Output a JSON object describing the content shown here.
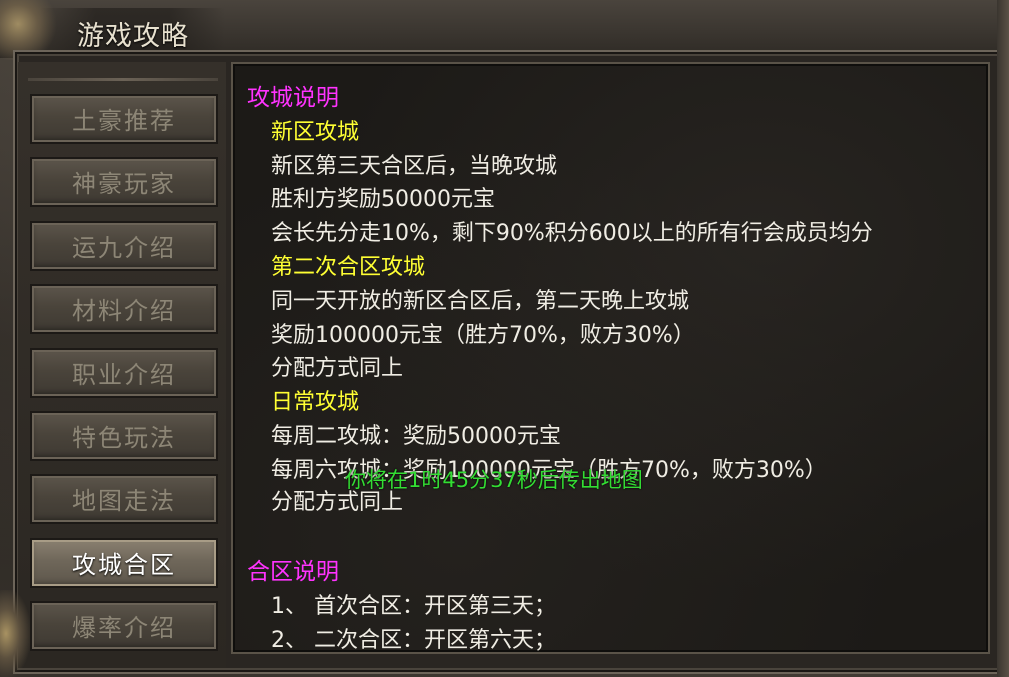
{
  "window": {
    "title": "游戏攻略"
  },
  "sidebar": {
    "items": [
      {
        "label": "土豪推荐",
        "active": false
      },
      {
        "label": "神豪玩家",
        "active": false
      },
      {
        "label": "运九介绍",
        "active": false
      },
      {
        "label": "材料介绍",
        "active": false
      },
      {
        "label": "职业介绍",
        "active": false
      },
      {
        "label": "特色玩法",
        "active": false
      },
      {
        "label": "地图走法",
        "active": false
      },
      {
        "label": "攻城合区",
        "active": true
      },
      {
        "label": "爆率介绍",
        "active": false
      }
    ]
  },
  "content": {
    "lines": [
      {
        "type": "h1",
        "text": "攻城说明"
      },
      {
        "type": "h2",
        "text": "新区攻城"
      },
      {
        "type": "body",
        "text": "新区第三天合区后，当晚攻城"
      },
      {
        "type": "body",
        "text": "胜利方奖励50000元宝"
      },
      {
        "type": "body",
        "text": "会长先分走10%，剩下90%积分600以上的所有行会成员均分"
      },
      {
        "type": "h2",
        "text": "第二次合区攻城"
      },
      {
        "type": "body",
        "text": "同一天开放的新区合区后，第二天晚上攻城"
      },
      {
        "type": "body",
        "text": "奖励100000元宝（胜方70%，败方30%）"
      },
      {
        "type": "body",
        "text": "分配方式同上"
      },
      {
        "type": "h2",
        "text": "日常攻城"
      },
      {
        "type": "body",
        "text": "每周二攻城：奖励50000元宝"
      },
      {
        "type": "body",
        "text": "每周六攻城：奖励100000元宝（胜方70%，败方30%）"
      },
      {
        "type": "body",
        "text": "分配方式同上"
      },
      {
        "type": "h1",
        "text": "合区说明"
      },
      {
        "type": "body",
        "text": "1、 首次合区：开区第三天；"
      },
      {
        "type": "body",
        "text": "2、 二次合区：开区第六天；"
      }
    ]
  },
  "overlay": {
    "message": "你将在1时45分37秒后传出地图"
  },
  "colors": {
    "heading_magenta": "#ff33ff",
    "subheading_yellow": "#ffff33",
    "body_text": "#f0ede4",
    "system_message_green": "#33dd33"
  }
}
